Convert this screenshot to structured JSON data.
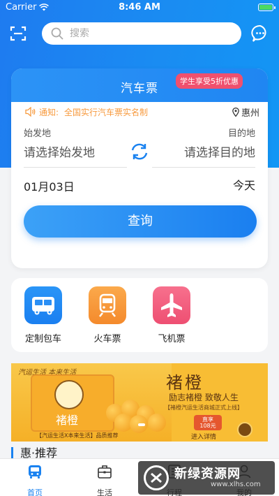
{
  "status_bar": {
    "carrier": "Carrier",
    "time": "8:46 AM"
  },
  "header": {
    "search_placeholder": "搜索"
  },
  "ticket": {
    "title": "汽车票",
    "promo": "学生享受5折优惠",
    "notice_label": "通知:",
    "notice_text": "全国实行汽车票实名制",
    "city": "惠州",
    "from_label": "始发地",
    "to_label": "目的地",
    "from_placeholder": "请选择始发地",
    "to_placeholder": "请选择目的地",
    "date": "01月03日",
    "day": "今天",
    "query_button": "查询"
  },
  "services": [
    {
      "label": "定制包车",
      "color": "#1e87f5",
      "icon": "bus-icon"
    },
    {
      "label": "火车票",
      "color": "#f7953b",
      "icon": "train-icon"
    },
    {
      "label": "飞机票",
      "color": "#f05a7c",
      "icon": "plane-icon"
    }
  ],
  "banner": {
    "brand": "汽运生活 本来生活",
    "title": "褚橙",
    "slogan": "励志褚橙 致敬人生",
    "sub": "【褚橙汽运生活商城正式上线】",
    "price": "108元",
    "price_top": "直享",
    "cta": "进入详情",
    "caption": "【汽运生活X本来生活】品质推荐",
    "box_label": "褚橙"
  },
  "section_title": "惠·推荐",
  "tabs": [
    {
      "label": "首页",
      "icon": "home-bus-icon",
      "active": true
    },
    {
      "label": "生活",
      "icon": "briefcase-icon",
      "active": false
    },
    {
      "label": "行程",
      "icon": "itinerary-icon",
      "active": false
    },
    {
      "label": "我的",
      "icon": "profile-icon",
      "active": false
    }
  ],
  "watermark": {
    "title": "新绿资源网",
    "url": "www.xlhs.com"
  },
  "colors": {
    "primary": "#1a82f0",
    "promo": "#f0506e",
    "notice": "#f79a3e"
  }
}
